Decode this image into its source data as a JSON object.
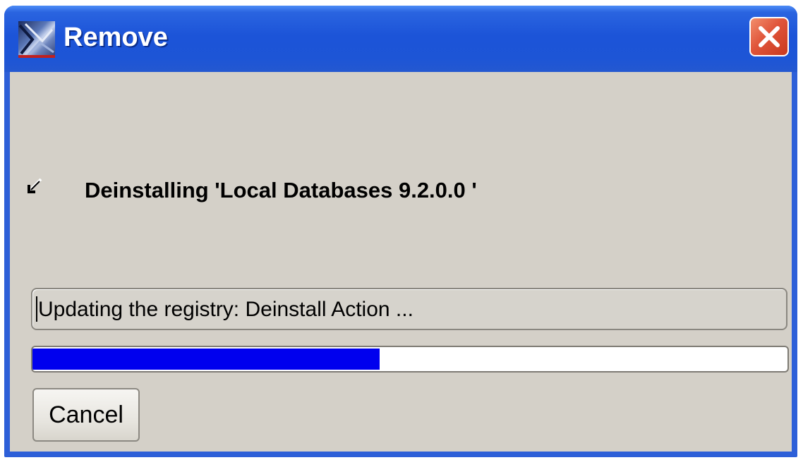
{
  "window": {
    "title": "Remove",
    "title_icon": "oracle-installer-icon",
    "close_icon": "close-icon",
    "titlebar_color": "#1d55d6",
    "close_color": "#e0553a"
  },
  "main": {
    "heading": "Deinstalling 'Local Databases 9.2.0.0 '",
    "status_glyph": "busy-indicator-icon",
    "status_text": "Updating the registry: Deinstall Action ...",
    "progress": {
      "value": 0.46,
      "fill_color": "#0000ee"
    }
  },
  "buttons": {
    "cancel_label": "Cancel"
  }
}
